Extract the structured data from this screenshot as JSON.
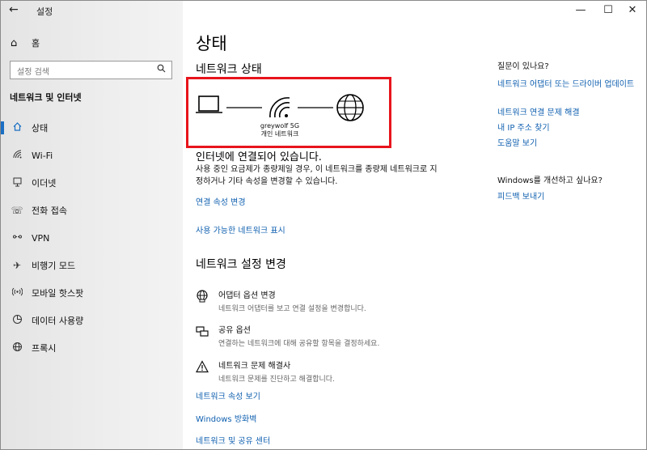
{
  "window": {
    "title": "설정"
  },
  "sidebar": {
    "home_label": "홈",
    "search_placeholder": "설정 검색",
    "section_title": "네트워크 및 인터넷",
    "items": [
      {
        "label": "상태",
        "icon": "home-status-icon"
      },
      {
        "label": "Wi-Fi",
        "icon": "wifi-icon"
      },
      {
        "label": "이더넷",
        "icon": "ethernet-icon"
      },
      {
        "label": "전화 접속",
        "icon": "dialup-icon"
      },
      {
        "label": "VPN",
        "icon": "vpn-icon"
      },
      {
        "label": "비행기 모드",
        "icon": "airplane-icon"
      },
      {
        "label": "모바일 핫스팟",
        "icon": "hotspot-icon"
      },
      {
        "label": "데이터 사용량",
        "icon": "data-usage-icon"
      },
      {
        "label": "프록시",
        "icon": "proxy-icon"
      }
    ]
  },
  "main": {
    "title": "상태",
    "network_status_heading": "네트워크 상태",
    "network_name": "greywolf 5G",
    "network_type": "개인 네트워크",
    "connected_text": "인터넷에 연결되어 있습니다.",
    "metered_desc": "사용 중인 요금제가 종량제일 경우, 이 네트워크를 종량제 네트워크로 지정하거나 기타 속성을 변경할 수 있습니다.",
    "change_props_link": "연결 속성 변경",
    "show_networks_link": "사용 가능한 네트워크 표시",
    "change_settings_heading": "네트워크 설정 변경",
    "options": [
      {
        "title": "어댑터 옵션 변경",
        "subtitle": "네트워크 어댑터를 보고 연결 설정을 변경합니다."
      },
      {
        "title": "공유 옵션",
        "subtitle": "연결하는 네트워크에 대해 공유할 항목을 결정하세요."
      },
      {
        "title": "네트워크 문제 해결사",
        "subtitle": "네트워크 문제를 진단하고 해결합니다."
      }
    ],
    "bottom_links": [
      "네트워크 속성 보기",
      "Windows 방화벽",
      "네트워크 및 공유 센터"
    ]
  },
  "right": {
    "question_heading": "질문이 있나요?",
    "links": [
      "네트워크 어댑터 또는 드라이버 업데이트",
      "네트워크 연결 문제 해결",
      "내 IP 주소 찾기",
      "도움말 보기"
    ],
    "improve_heading": "Windows를 개선하고 싶나요?",
    "feedback_link": "피드백 보내기"
  },
  "colors": {
    "accent": "#1a6fc4",
    "link": "#1060b0",
    "highlight_box": "#e8141c"
  }
}
